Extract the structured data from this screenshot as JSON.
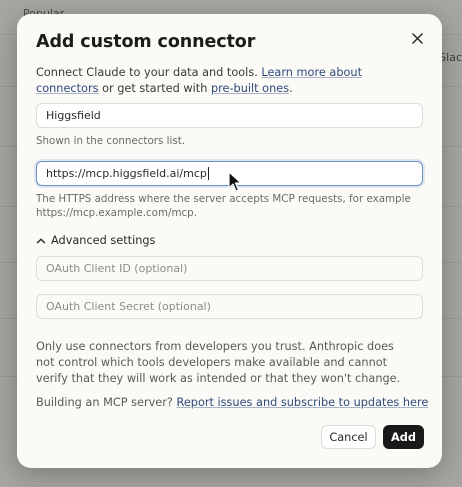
{
  "background": {
    "section_label": "Popular",
    "right_edge_text": "Slac"
  },
  "modal": {
    "title": "Add custom connector",
    "close_icon": "close-icon",
    "intro_text_1": "Connect Claude to your data and tools. ",
    "intro_link_1": "Learn more about connectors",
    "intro_text_2": " or get started with ",
    "intro_link_2": "pre-built ones",
    "intro_text_3": ".",
    "name_field": {
      "value": "Higgsfield"
    },
    "name_helper": "Shown in the connectors list.",
    "url_field": {
      "value": "https://mcp.higgsfield.ai/mcp"
    },
    "url_helper": "The HTTPS address where the server accepts MCP requests, for example https://mcp.example.com/mcp.",
    "advanced_label": "Advanced settings",
    "advanced_icon": "chevron-up-icon",
    "oauth_client_id": {
      "placeholder": "OAuth Client ID (optional)"
    },
    "oauth_client_secret": {
      "placeholder": "OAuth Client Secret (optional)"
    },
    "warning": "Only use connectors from developers you trust. Anthropic does not control which tools developers make available and cannot verify that they will work as intended or that they won't change.",
    "building_text": "Building an MCP server? ",
    "building_link": "Report issues and subscribe to updates here",
    "cancel_label": "Cancel",
    "add_label": "Add"
  },
  "colors": {
    "primary_button": "#1a1917",
    "link": "#2f4a7a",
    "focus_border": "#6a8fc7"
  }
}
